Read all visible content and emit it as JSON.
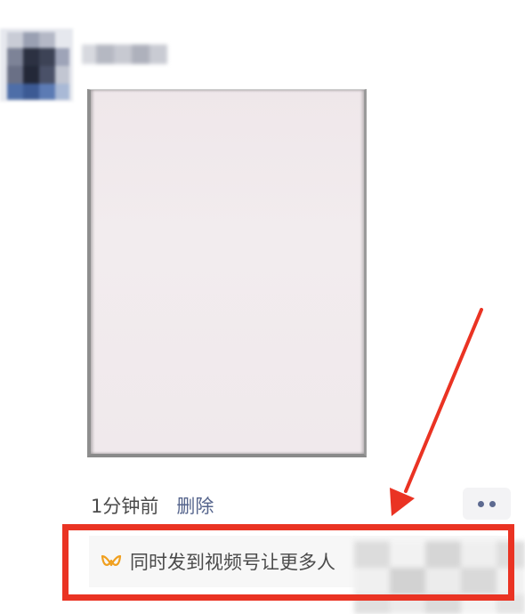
{
  "post": {
    "time": "1分钟前",
    "delete_label": "删除"
  },
  "share_bar": {
    "text": "同时发到视频号让更多人"
  },
  "icons": {
    "more": "more-dots-icon",
    "channel": "video-channel-icon"
  },
  "colors": {
    "link": "#55648c",
    "annotation": "#ea3323",
    "channel_icon": "#f0a020"
  }
}
